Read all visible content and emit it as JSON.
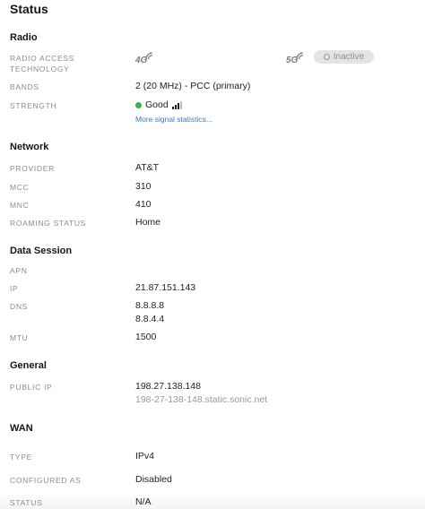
{
  "page_title": "Status",
  "radio": {
    "heading": "Radio",
    "rat_label": "RADIO ACCESS TECHNOLOGY",
    "icon_4g": "4G",
    "icon_5g": "5G",
    "status_5g": "Inactive",
    "bands_label": "BANDS",
    "bands_value": "2 (20 MHz) - PCC (primary)",
    "strength_label": "STRENGTH",
    "strength_value": "Good",
    "strength_bars_active": 3,
    "strength_bars_total": 4,
    "signal_link": "More signal statistics..."
  },
  "network": {
    "heading": "Network",
    "provider_label": "PROVIDER",
    "provider_value": "AT&T",
    "mcc_label": "MCC",
    "mcc_value": "310",
    "mnc_label": "MNC",
    "mnc_value": "410",
    "roaming_label": "ROAMING STATUS",
    "roaming_value": "Home"
  },
  "data_session": {
    "heading": "Data Session",
    "apn_label": "APN",
    "ip_label": "IP",
    "ip_value": "21.87.151.143",
    "dns_label": "DNS",
    "dns_value_1": "8.8.8.8",
    "dns_value_2": "8.8.4.4",
    "mtu_label": "MTU",
    "mtu_value": "1500"
  },
  "general": {
    "heading": "General",
    "public_ip_label": "PUBLIC IP",
    "public_ip_value": "198.27.138.148",
    "public_ip_host": "198-27-138-148.static.sonic.net"
  },
  "wan": {
    "heading": "WAN",
    "type_label": "TYPE",
    "type_value": "IPv4",
    "configured_label": "CONFIGURED AS",
    "configured_value": "Disabled",
    "status_label": "STATUS",
    "status_value": "N/A"
  },
  "colors": {
    "good": "#3cb04a",
    "link": "#3a78c9",
    "label": "#8c8c8c"
  }
}
